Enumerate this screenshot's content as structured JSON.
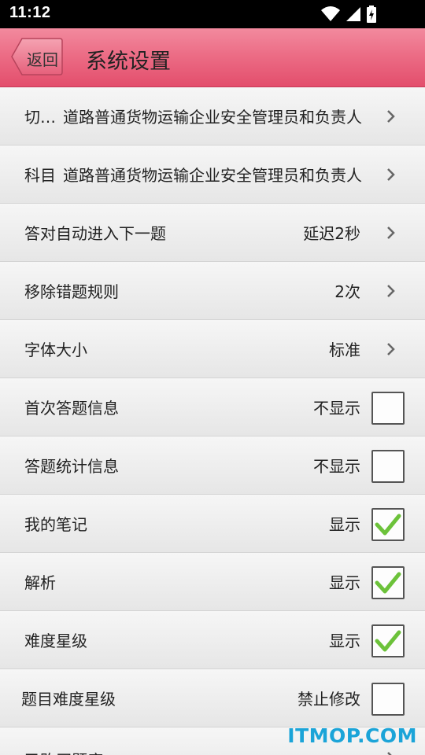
{
  "status_bar": {
    "time": "11:12"
  },
  "header": {
    "back_label": "返回",
    "title": "系统设置"
  },
  "settings": [
    {
      "label": "切换车型",
      "title": "道路普通货物运输企业安全管理员和负责人",
      "type": "nav"
    },
    {
      "label": "科目",
      "title": "道路普通货物运输企业安全管理员和负责人",
      "type": "nav"
    },
    {
      "label": "答对自动进入下一题",
      "value": "延迟2秒",
      "type": "nav"
    },
    {
      "label": "移除错题规则",
      "value": "2次",
      "type": "nav"
    },
    {
      "label": "字体大小",
      "value": "标准",
      "type": "nav"
    },
    {
      "label": "首次答题信息",
      "value": "不显示",
      "type": "check",
      "checked": false
    },
    {
      "label": "答题统计信息",
      "value": "不显示",
      "type": "check",
      "checked": false
    },
    {
      "label": "我的笔记",
      "value": "显示",
      "type": "check",
      "checked": true
    },
    {
      "label": "解析",
      "value": "显示",
      "type": "check",
      "checked": true
    },
    {
      "label": "难度星级",
      "value": "显示",
      "type": "check",
      "checked": true
    },
    {
      "label": "题目难度星级",
      "value": "禁止修改",
      "type": "check",
      "checked": false
    },
    {
      "label": "已购买题库",
      "value": "",
      "type": "nav"
    }
  ],
  "watermark": "ITMOP.COM",
  "colors": {
    "header": "#ec6d86",
    "check": "#6cc23a",
    "watermark": "#1ba4d8"
  }
}
